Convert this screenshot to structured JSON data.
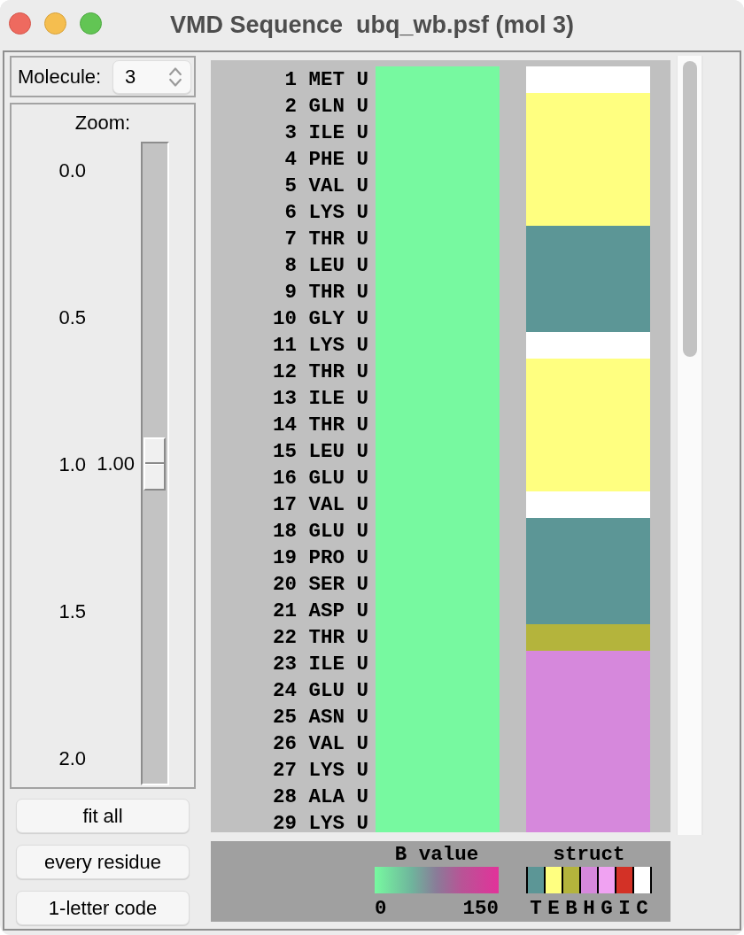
{
  "window": {
    "title": "VMD Sequence  ubq_wb.psf (mol 3)"
  },
  "molecule": {
    "label": "Molecule:",
    "value": "3"
  },
  "zoom": {
    "label": "Zoom:",
    "ticks": [
      "0.0",
      "0.5",
      "1.0",
      "1.5",
      "2.0"
    ],
    "value": "1.00",
    "level": 0.5
  },
  "buttons": [
    {
      "label": "fit all"
    },
    {
      "label": "every residue"
    },
    {
      "label": "1-letter code"
    }
  ],
  "residues": [
    {
      "number": "1",
      "resname": "MET",
      "chain": "U",
      "bvalue": {
        "color": "#77f9a0"
      },
      "structure": {
        "color": "#ffffff"
      }
    },
    {
      "number": "2",
      "resname": "GLN",
      "chain": "U",
      "bvalue": {
        "color": "#77f9a0"
      },
      "structure": {
        "color": "#ffff80"
      }
    },
    {
      "number": "3",
      "resname": "ILE",
      "chain": "U",
      "bvalue": {
        "color": "#77f9a0"
      },
      "structure": {
        "color": "#ffff80"
      }
    },
    {
      "number": "4",
      "resname": "PHE",
      "chain": "U",
      "bvalue": {
        "color": "#77f9a0"
      },
      "structure": {
        "color": "#ffff80"
      }
    },
    {
      "number": "5",
      "resname": "VAL",
      "chain": "U",
      "bvalue": {
        "color": "#77f9a0"
      },
      "structure": {
        "color": "#ffff80"
      }
    },
    {
      "number": "6",
      "resname": "LYS",
      "chain": "U",
      "bvalue": {
        "color": "#77f9a0"
      },
      "structure": {
        "color": "#ffff80"
      }
    },
    {
      "number": "7",
      "resname": "THR",
      "chain": "U",
      "bvalue": {
        "color": "#77f9a0"
      },
      "structure": {
        "color": "#5c9696"
      }
    },
    {
      "number": "8",
      "resname": "LEU",
      "chain": "U",
      "bvalue": {
        "color": "#77f9a0"
      },
      "structure": {
        "color": "#5c9696"
      }
    },
    {
      "number": "9",
      "resname": "THR",
      "chain": "U",
      "bvalue": {
        "color": "#77f9a0"
      },
      "structure": {
        "color": "#5c9696"
      }
    },
    {
      "number": "10",
      "resname": "GLY",
      "chain": "U",
      "bvalue": {
        "color": "#77f9a0"
      },
      "structure": {
        "color": "#5c9696"
      }
    },
    {
      "number": "11",
      "resname": "LYS",
      "chain": "U",
      "bvalue": {
        "color": "#77f9a0"
      },
      "structure": {
        "color": "#ffffff"
      }
    },
    {
      "number": "12",
      "resname": "THR",
      "chain": "U",
      "bvalue": {
        "color": "#77f9a0"
      },
      "structure": {
        "color": "#ffff80"
      }
    },
    {
      "number": "13",
      "resname": "ILE",
      "chain": "U",
      "bvalue": {
        "color": "#77f9a0"
      },
      "structure": {
        "color": "#ffff80"
      }
    },
    {
      "number": "14",
      "resname": "THR",
      "chain": "U",
      "bvalue": {
        "color": "#77f9a0"
      },
      "structure": {
        "color": "#ffff80"
      }
    },
    {
      "number": "15",
      "resname": "LEU",
      "chain": "U",
      "bvalue": {
        "color": "#77f9a0"
      },
      "structure": {
        "color": "#ffff80"
      }
    },
    {
      "number": "16",
      "resname": "GLU",
      "chain": "U",
      "bvalue": {
        "color": "#77f9a0"
      },
      "structure": {
        "color": "#ffff80"
      }
    },
    {
      "number": "17",
      "resname": "VAL",
      "chain": "U",
      "bvalue": {
        "color": "#77f9a0"
      },
      "structure": {
        "color": "#ffffff"
      }
    },
    {
      "number": "18",
      "resname": "GLU",
      "chain": "U",
      "bvalue": {
        "color": "#77f9a0"
      },
      "structure": {
        "color": "#5c9696"
      }
    },
    {
      "number": "19",
      "resname": "PRO",
      "chain": "U",
      "bvalue": {
        "color": "#77f9a0"
      },
      "structure": {
        "color": "#5c9696"
      }
    },
    {
      "number": "20",
      "resname": "SER",
      "chain": "U",
      "bvalue": {
        "color": "#77f9a0"
      },
      "structure": {
        "color": "#5c9696"
      }
    },
    {
      "number": "21",
      "resname": "ASP",
      "chain": "U",
      "bvalue": {
        "color": "#77f9a0"
      },
      "structure": {
        "color": "#5c9696"
      }
    },
    {
      "number": "22",
      "resname": "THR",
      "chain": "U",
      "bvalue": {
        "color": "#77f9a0"
      },
      "structure": {
        "color": "#b4b43c"
      }
    },
    {
      "number": "23",
      "resname": "ILE",
      "chain": "U",
      "bvalue": {
        "color": "#77f9a0"
      },
      "structure": {
        "color": "#d688dc"
      }
    },
    {
      "number": "24",
      "resname": "GLU",
      "chain": "U",
      "bvalue": {
        "color": "#77f9a0"
      },
      "structure": {
        "color": "#d688dc"
      }
    },
    {
      "number": "25",
      "resname": "ASN",
      "chain": "U",
      "bvalue": {
        "color": "#77f9a0"
      },
      "structure": {
        "color": "#d688dc"
      }
    },
    {
      "number": "26",
      "resname": "VAL",
      "chain": "U",
      "bvalue": {
        "color": "#77f9a0"
      },
      "structure": {
        "color": "#d688dc"
      }
    },
    {
      "number": "27",
      "resname": "LYS",
      "chain": "U",
      "bvalue": {
        "color": "#77f9a0"
      },
      "structure": {
        "color": "#d688dc"
      }
    },
    {
      "number": "28",
      "resname": "ALA",
      "chain": "U",
      "bvalue": {
        "color": "#77f9a0"
      },
      "structure": {
        "color": "#d688dc"
      }
    },
    {
      "number": "29",
      "resname": "LYS",
      "chain": "U",
      "bvalue": {
        "color": "#77f9a0"
      },
      "structure": {
        "color": "#d688dc"
      }
    }
  ],
  "legend": {
    "bvalue": {
      "title": "B value",
      "min": "0",
      "max": "150"
    },
    "struct": {
      "title": "struct",
      "items": [
        {
          "label": "T",
          "color": "#5c9696"
        },
        {
          "label": "E",
          "color": "#ffff80"
        },
        {
          "label": "B",
          "color": "#b4b43c"
        },
        {
          "label": "H",
          "color": "#d688dc"
        },
        {
          "label": "G",
          "color": "#f0a2f2"
        },
        {
          "label": "I",
          "color": "#d33126"
        },
        {
          "label": "C",
          "color": "#ffffff"
        }
      ]
    }
  }
}
